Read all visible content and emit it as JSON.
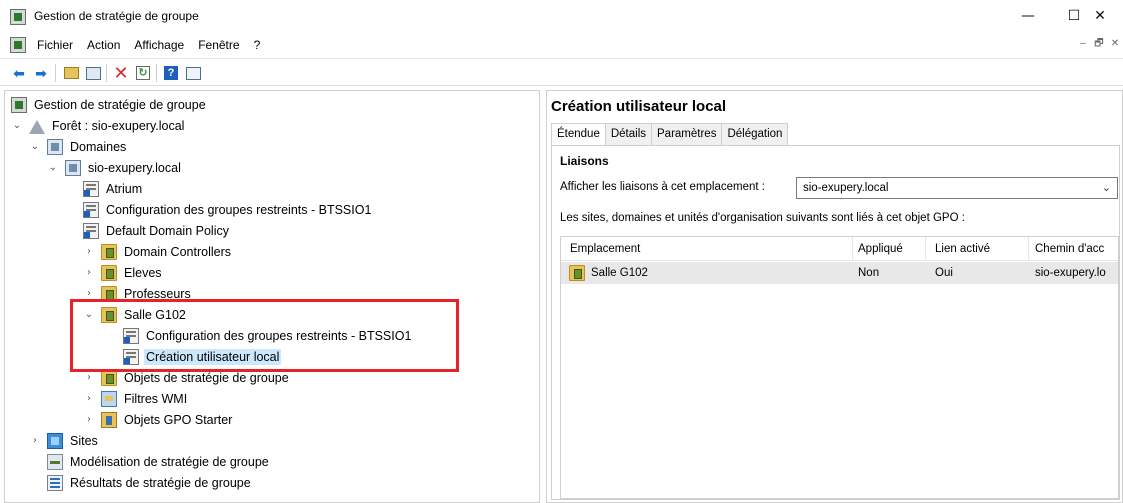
{
  "window": {
    "title": "Gestion de stratégie de groupe",
    "controls": [
      "—",
      "☐",
      "✕"
    ]
  },
  "menu": [
    "Fichier",
    "Action",
    "Affichage",
    "Fenêtre",
    "?"
  ],
  "mdi_controls": [
    "–",
    "🗗",
    "✕"
  ],
  "toolbar": {
    "buttons": [
      "back-arrow-icon",
      "forward-arrow-icon",
      "up-folder-icon",
      "show-hide-tree-icon",
      "delete-icon",
      "refresh-icon",
      "help-icon",
      "properties-icon"
    ],
    "colors": {
      "arrow": "#1a6fd1",
      "delete": "#d62b2b",
      "refresh": "#2f8f3a",
      "help": "#1d5fbf"
    }
  },
  "tree": {
    "root": "Gestion de stratégie de groupe",
    "forest": "Forêt : sio-exupery.local",
    "domains": "Domaines",
    "domain": "sio-exupery.local",
    "items": {
      "atrium": "Atrium",
      "config_restricted": "Configuration des groupes restreints - BTSSIO1",
      "default_domain_policy": "Default Domain Policy",
      "domain_controllers": "Domain Controllers",
      "eleves": "Eleves",
      "professeurs": "Professeurs",
      "salle_g102": "Salle G102",
      "salle_config": "Configuration des groupes restreints - BTSSIO1",
      "salle_creation": "Création utilisateur local",
      "gpo_objects": "Objets de stratégie de groupe",
      "wmi_filters": "Filtres WMI",
      "starter_gpo": "Objets GPO Starter"
    },
    "sites": "Sites",
    "modeling": "Modélisation de stratégie de groupe",
    "results": "Résultats de stratégie de groupe",
    "highlight_color": "#e5232a"
  },
  "details": {
    "title": "Création utilisateur local",
    "tabs": [
      "Étendue",
      "Détails",
      "Paramètres",
      "Délégation"
    ],
    "section": "Liaisons",
    "show_links_label": "Afficher les liaisons à cet emplacement :",
    "location_value": "sio-exupery.local",
    "linked_label": "Les sites, domaines et unités d'organisation suivants sont liés à cet objet GPO :",
    "columns": [
      "Emplacement",
      "Appliqué",
      "Lien activé",
      "Chemin d'acc"
    ],
    "rows": [
      {
        "location": "Salle G102",
        "enforced": "Non",
        "enabled": "Oui",
        "path": "sio-exupery.lo"
      }
    ]
  }
}
